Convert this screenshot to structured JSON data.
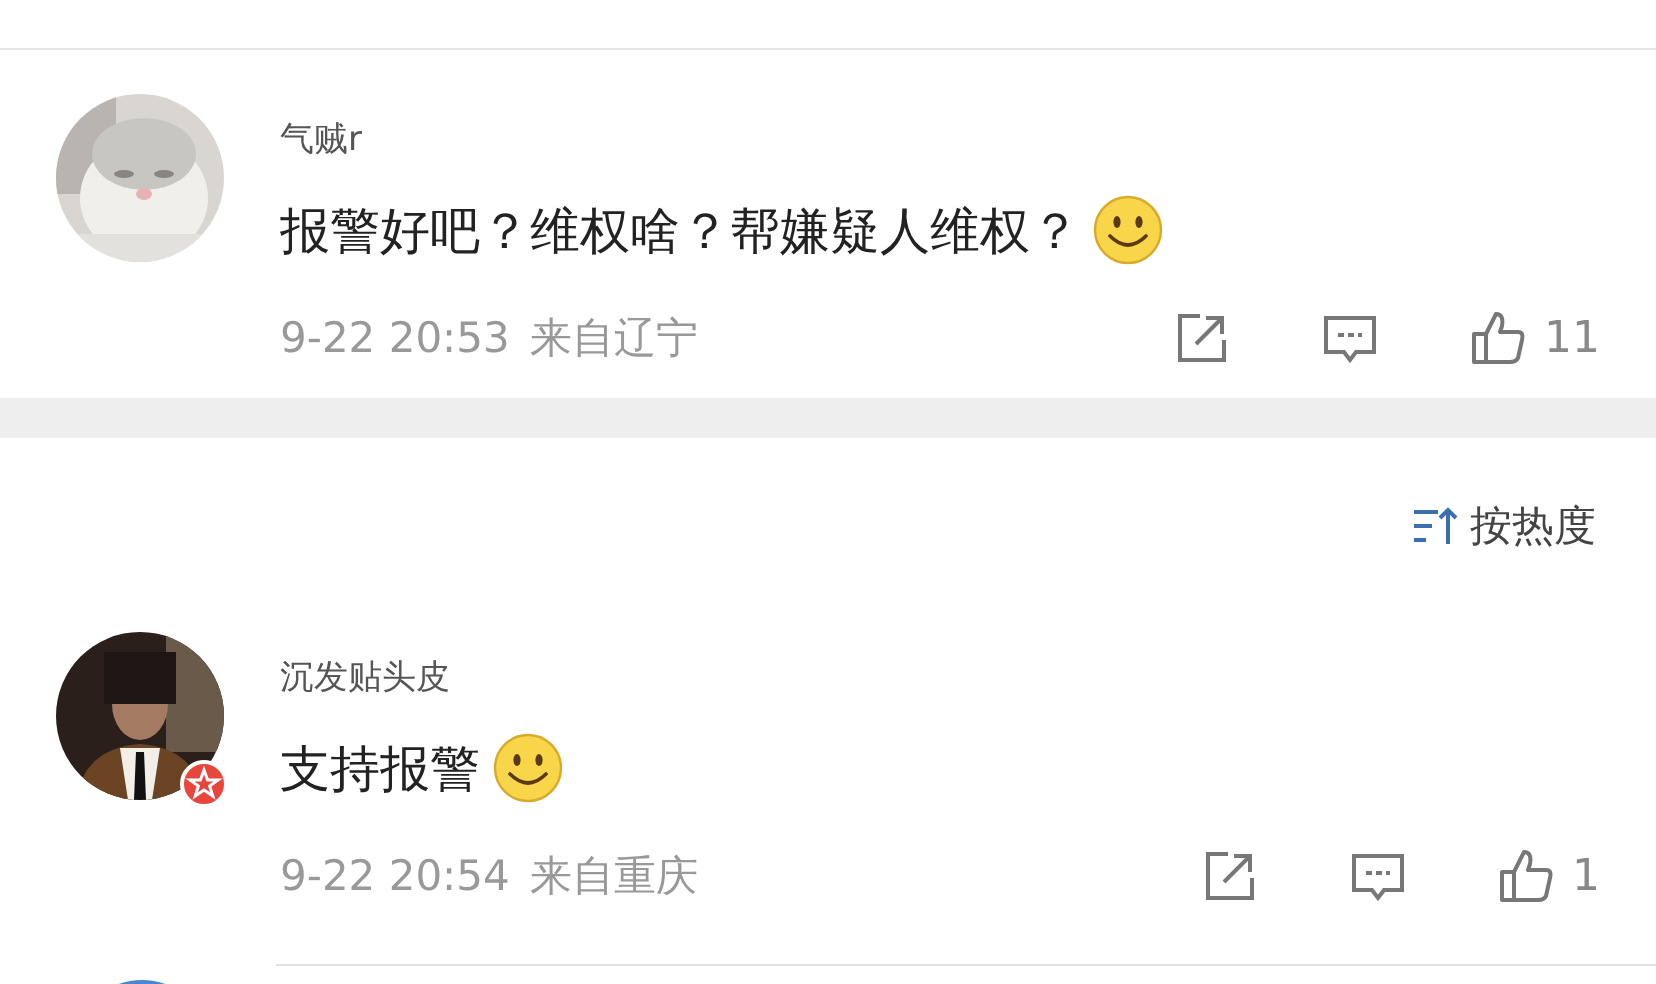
{
  "comments": [
    {
      "user": "气贼r",
      "text": "报警好吧？维权啥？帮嫌疑人维权？",
      "time": "9-22 20:53",
      "location": "来自辽宁",
      "likes": "11",
      "verified": false
    },
    {
      "sort_label": "按热度"
    },
    {
      "user": "沉发贴头皮",
      "text": "支持报警",
      "time": "9-22 20:54",
      "location": "来自重庆",
      "likes": "1",
      "verified": true
    }
  ]
}
